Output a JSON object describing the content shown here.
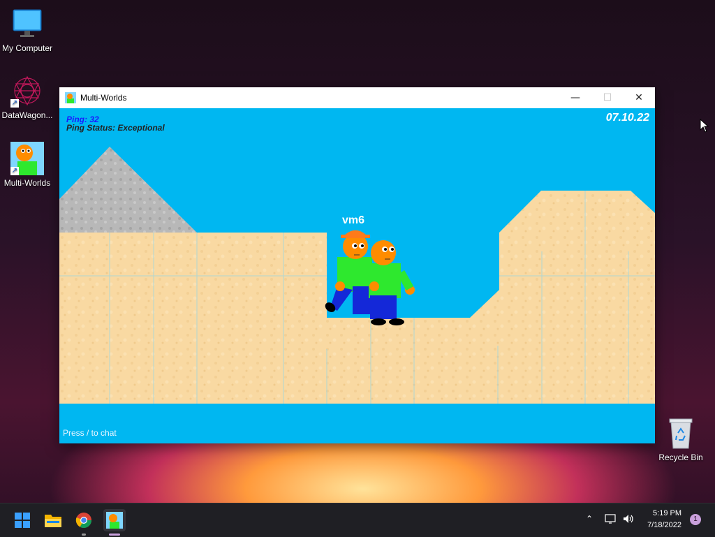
{
  "desktop": {
    "icons": [
      {
        "label": "My Computer",
        "icon": "monitor-icon"
      },
      {
        "label": "DataWagon...",
        "icon": "datawagon-icon"
      },
      {
        "label": "Multi-Worlds",
        "icon": "multiworlds-icon"
      },
      {
        "label": "Recycle Bin",
        "icon": "recycle-bin-icon"
      }
    ]
  },
  "window": {
    "title": "Multi-Worlds",
    "minimize_glyph": "—",
    "maximize_glyph": "☐",
    "close_glyph": "✕"
  },
  "game": {
    "ping": "Ping: 32",
    "ping_status": "Ping Status: Exceptional",
    "date": "07.10.22",
    "player_name": "vm6",
    "chat_hint": "Press / to chat"
  },
  "taskbar": {
    "items": [
      "start-icon",
      "file-explorer-icon",
      "chrome-icon",
      "multiworlds-icon"
    ],
    "time": "5:19 PM",
    "date": "7/18/2022",
    "notifications": "1"
  },
  "colors": {
    "sky": "#00b7f1",
    "sand": "#f9d9a2",
    "rock": "#b6b6b6",
    "player_shirt": "#2ee82e",
    "player_pants": "#1428d8",
    "player_head": "#ff8c00"
  }
}
